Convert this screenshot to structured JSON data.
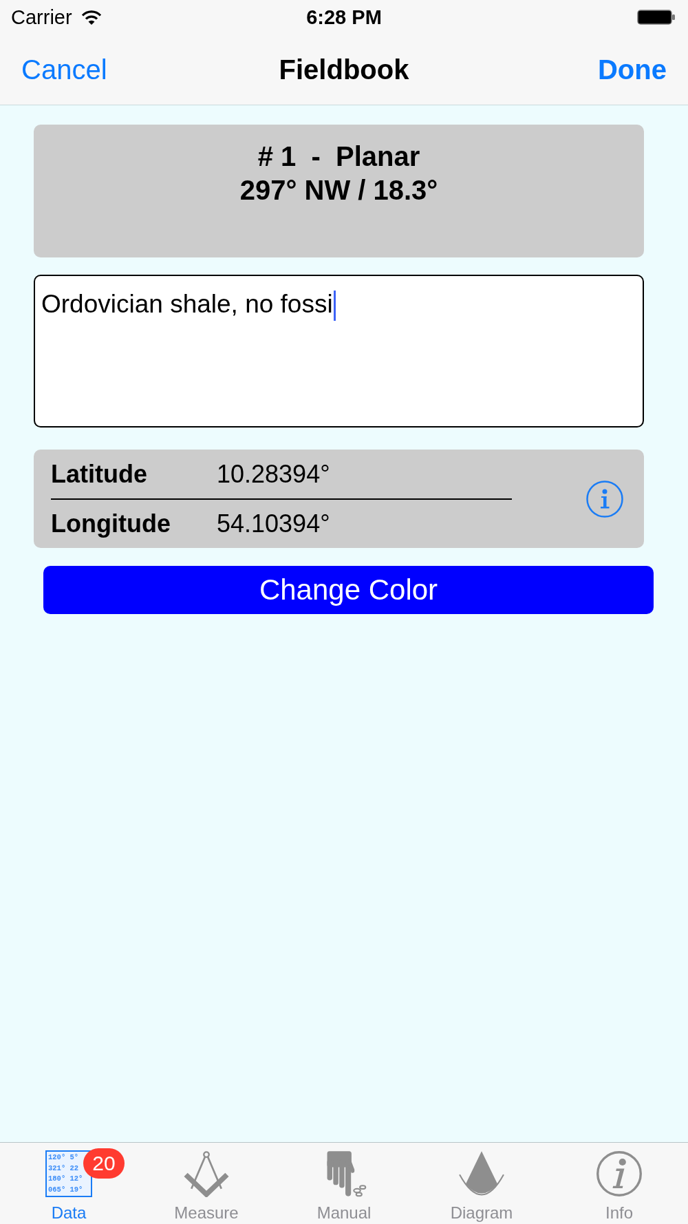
{
  "status_bar": {
    "carrier": "Carrier",
    "time": "6:28 PM"
  },
  "nav_bar": {
    "cancel": "Cancel",
    "title": "Fieldbook",
    "done": "Done"
  },
  "record": {
    "title": "# 1  -  Planar",
    "orientation": "297° NW / 18.3°"
  },
  "notes": {
    "value": "Ordovician shale, no fossi",
    "focused": true
  },
  "location": {
    "rows": [
      {
        "label": "Latitude",
        "value": "10.28394°"
      },
      {
        "label": "Longitude",
        "value": "54.10394°"
      }
    ]
  },
  "change_color_button": "Change Color",
  "tab_bar": [
    {
      "label": "Data",
      "selected": true,
      "badge": "20",
      "icon_lines": [
        "120° 5°",
        "321° 22",
        "180° 12°",
        "065° 19°"
      ]
    },
    {
      "label": "Measure",
      "selected": false
    },
    {
      "label": "Manual",
      "selected": false
    },
    {
      "label": "Diagram",
      "selected": false
    },
    {
      "label": "Info",
      "selected": false
    }
  ]
}
